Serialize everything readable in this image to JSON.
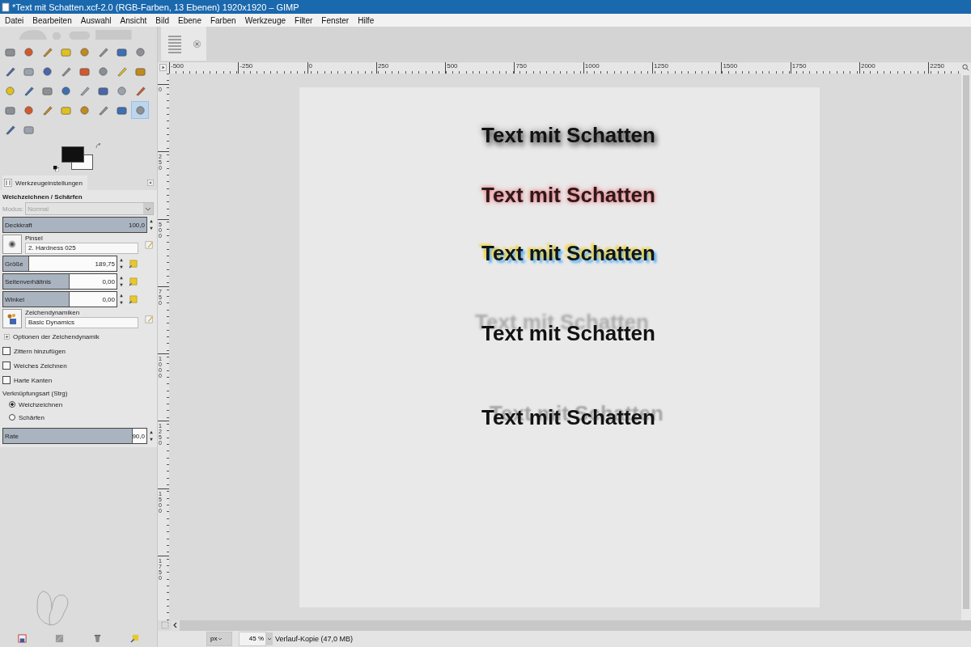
{
  "window": {
    "title": "*Text mit Schatten.xcf-2.0 (RGB-Farben, 13 Ebenen) 1920x1920 – GIMP"
  },
  "menu": [
    "Datei",
    "Bearbeiten",
    "Auswahl",
    "Ansicht",
    "Bild",
    "Ebene",
    "Farben",
    "Werkzeuge",
    "Filter",
    "Fenster",
    "Hilfe"
  ],
  "toolbox": {
    "tools": [
      {
        "selected": false
      },
      {
        "selected": false
      },
      {
        "selected": false
      },
      {
        "selected": false
      },
      {
        "selected": false
      },
      {
        "selected": false
      },
      {
        "selected": false
      },
      {
        "selected": false
      },
      {
        "selected": false
      },
      {
        "selected": false
      },
      {
        "selected": false
      },
      {
        "selected": false
      },
      {
        "selected": false
      },
      {
        "selected": false
      },
      {
        "selected": false
      },
      {
        "selected": false
      },
      {
        "selected": false
      },
      {
        "selected": false
      },
      {
        "selected": false
      },
      {
        "selected": false
      },
      {
        "selected": false
      },
      {
        "selected": false
      },
      {
        "selected": false
      },
      {
        "selected": false
      },
      {
        "selected": false
      },
      {
        "selected": false
      },
      {
        "selected": false
      },
      {
        "selected": false
      },
      {
        "selected": false
      },
      {
        "selected": false
      },
      {
        "selected": false
      },
      {
        "selected": true
      },
      {
        "selected": false
      },
      {
        "selected": false
      }
    ]
  },
  "tool_options": {
    "tab": "Werkzeugeinstellungen",
    "title": "Weichzeichnen / Schärfen",
    "mode": {
      "label": "Modus:",
      "value": "Normal",
      "disabled": true
    },
    "opacity": {
      "label": "Deckkraft",
      "value": "100,0",
      "level": 1.0
    },
    "brush": {
      "label": "Pinsel",
      "value": "2. Hardness 025"
    },
    "sliders": [
      {
        "label": "Größe",
        "value": "189,75",
        "level": 0.22,
        "reset_button": true
      },
      {
        "label": "Seitenverhältnis",
        "value": "0,00",
        "level": 0.58,
        "reset_button": true
      },
      {
        "label": "Winkel",
        "value": "0,00",
        "level": 0.58,
        "reset_button": true
      }
    ],
    "dynamics": {
      "label": "Zeichendynamiken",
      "value": "Basic Dynamics"
    },
    "dynamics_options": {
      "label": "Optionen der Zeichendynamik",
      "expanded": false
    },
    "checkboxes": [
      {
        "label": "Zittern hinzufügen",
        "checked": false
      },
      {
        "label": "Weiches Zeichnen",
        "checked": false
      },
      {
        "label": "Harte Kanten",
        "checked": false
      }
    ],
    "convolve_type": {
      "label": "Verknüpfungsart (Strg)",
      "options": [
        {
          "label": "Weichzeichnen",
          "selected": true
        },
        {
          "label": "Schärfen",
          "selected": false
        }
      ]
    },
    "rate": {
      "label": "Rate",
      "value": "90,0",
      "level": 0.9
    }
  },
  "rulers": {
    "horizontal": [
      "-500",
      "-250",
      "0",
      "250",
      "500",
      "750",
      "1000",
      "1250",
      "1500",
      "1750",
      "2000",
      "2250"
    ],
    "vertical": [
      "0",
      "250",
      "500",
      "750",
      "1000",
      "1250",
      "1500",
      "1750"
    ]
  },
  "canvas": {
    "texts": [
      {
        "text": "Text mit Schatten",
        "kind": "blur"
      },
      {
        "text": "Text mit Schatten",
        "kind": "glow"
      },
      {
        "text": "Text mit Schatten",
        "kind": "duotone"
      },
      {
        "text": "Text mit Schatten",
        "kind": "perspective"
      },
      {
        "text": "Text mit Schatten",
        "kind": "cast"
      }
    ]
  },
  "status_bar": {
    "unit": "px",
    "zoom": "45 %",
    "message": "Verlauf-Kopie (47,0 MB)"
  }
}
